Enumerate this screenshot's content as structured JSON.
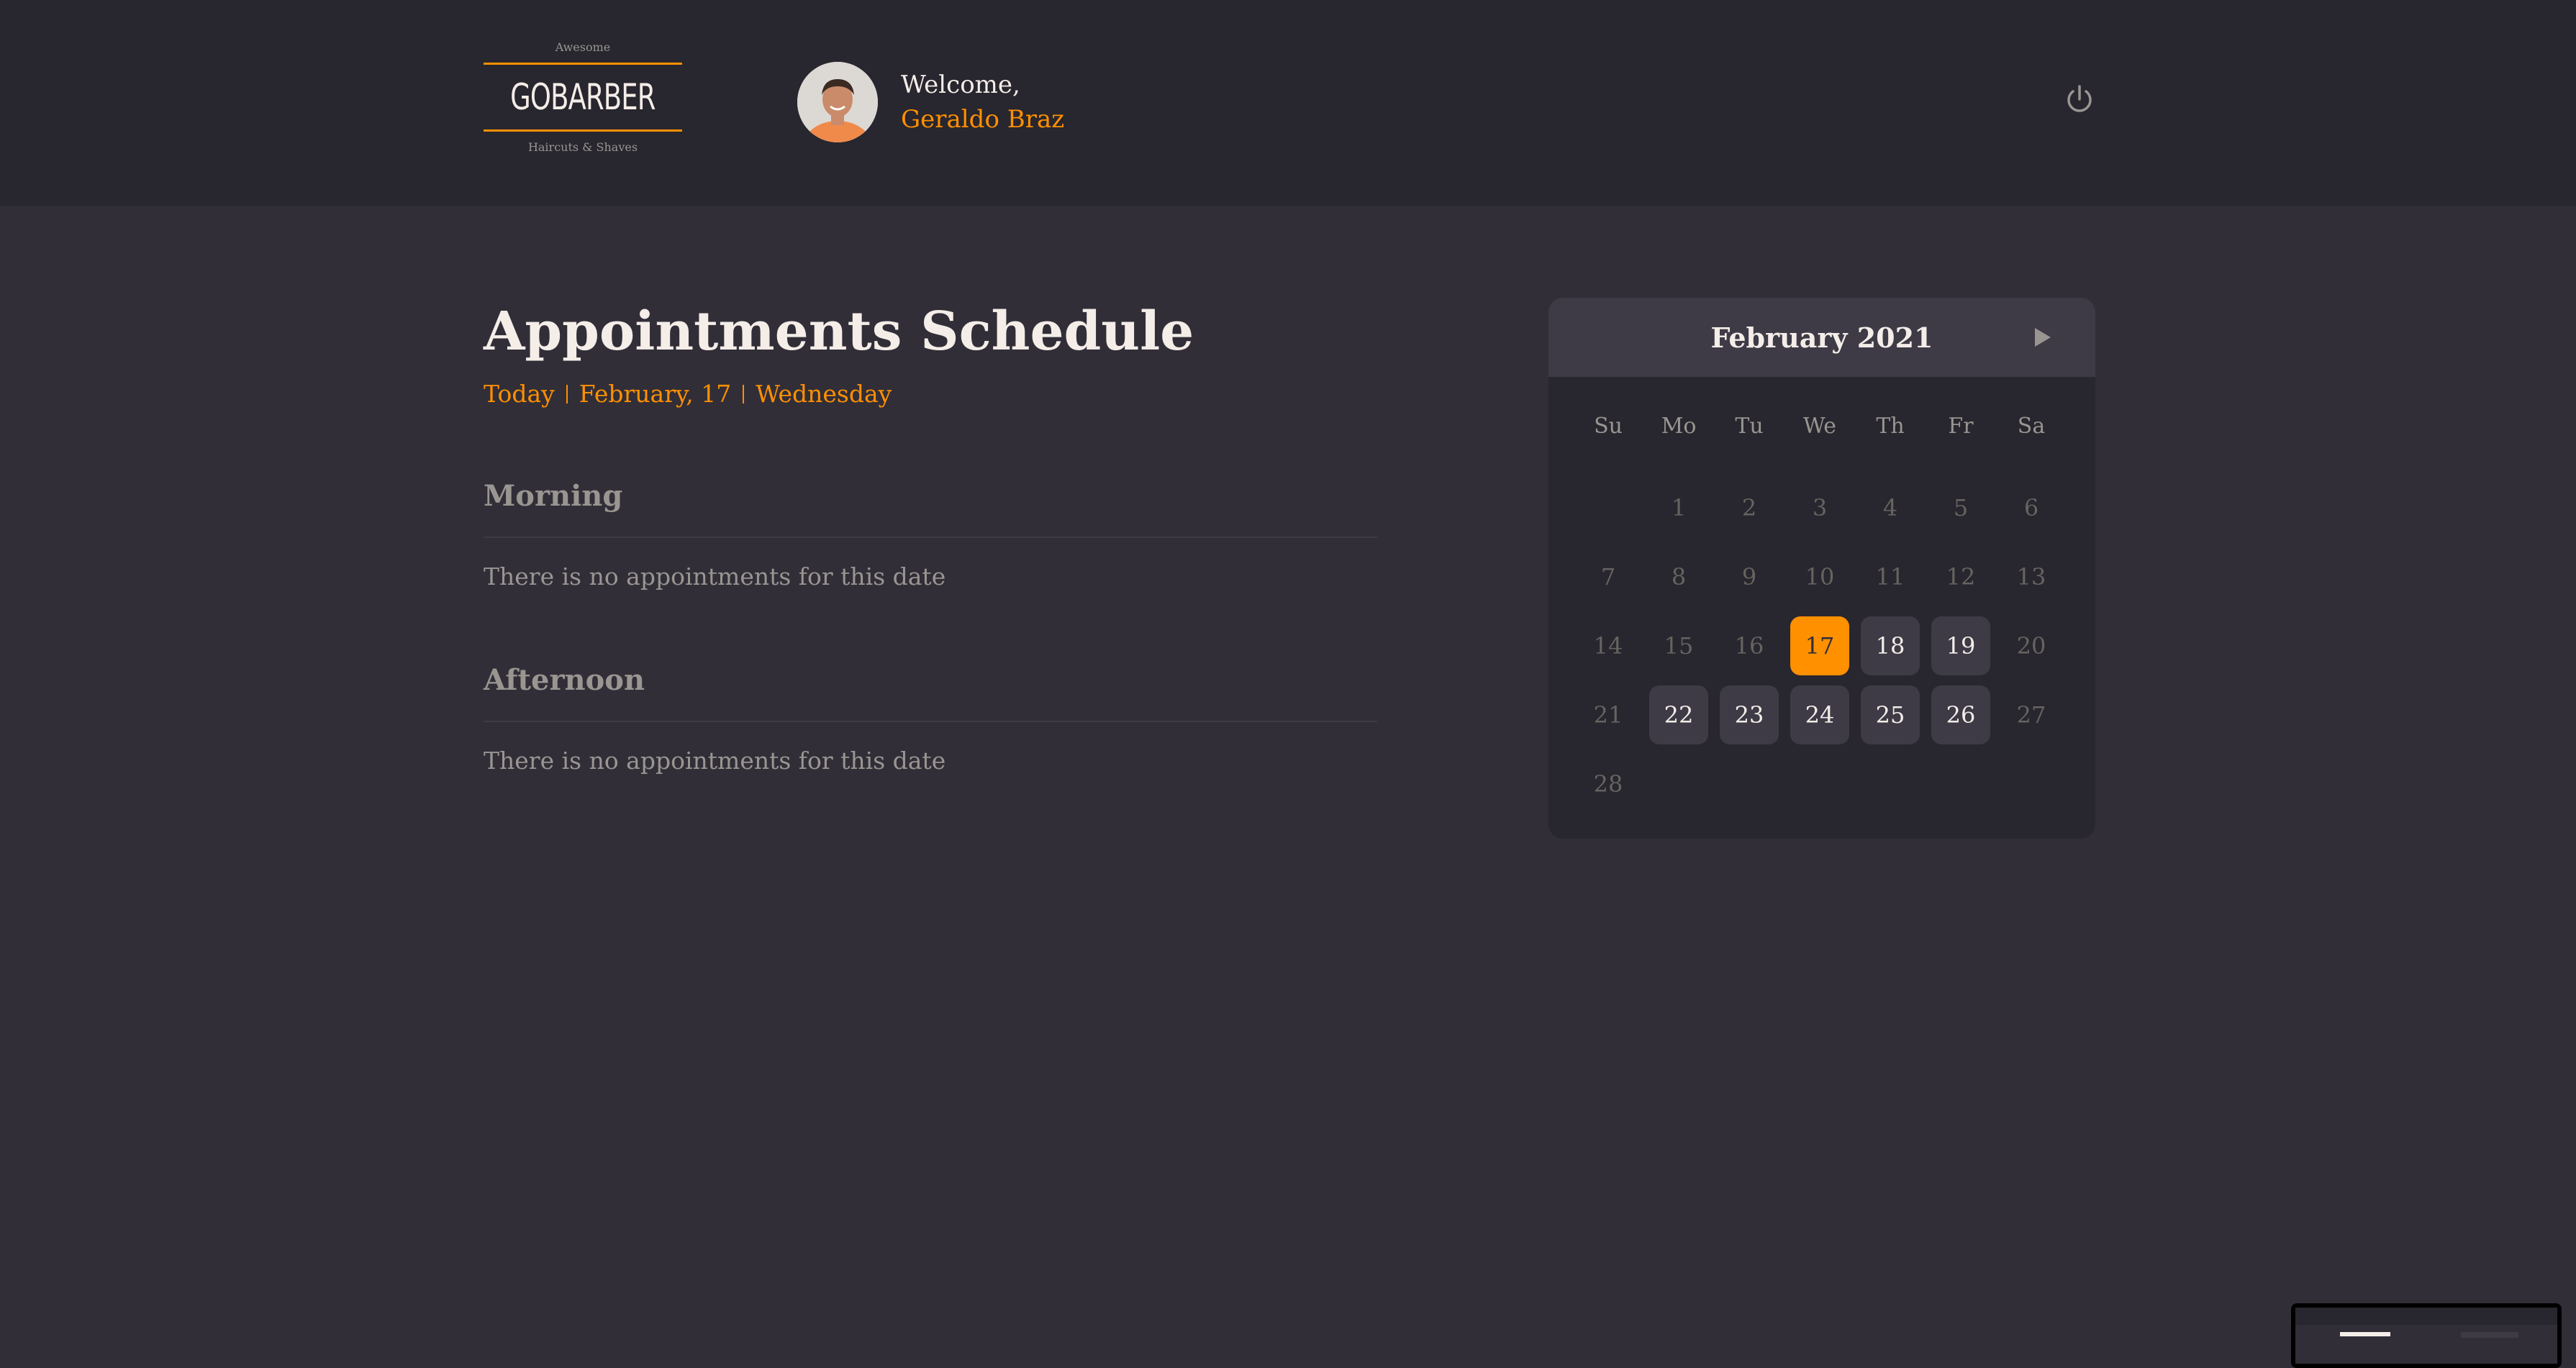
{
  "header": {
    "logo": {
      "top": "Awesome",
      "word": "GOBARBER",
      "bottom": "Haircuts & Shaves"
    },
    "welcome": "Welcome,",
    "user_name": "Geraldo Braz",
    "power_icon": "power-icon"
  },
  "main": {
    "title": "Appointments Schedule",
    "today": "Today",
    "date": "February, 17",
    "weekday": "Wednesday",
    "sections": [
      {
        "title": "Morning",
        "empty": "There is no appointments for this date"
      },
      {
        "title": "Afternoon",
        "empty": "There is no appointments for this date"
      }
    ]
  },
  "calendar": {
    "month": "February 2021",
    "next_icon": "chevron-right-icon",
    "weekdays": [
      "Su",
      "Mo",
      "Tu",
      "We",
      "Th",
      "Fr",
      "Sa"
    ],
    "days": [
      "",
      "1",
      "2",
      "3",
      "4",
      "5",
      "6",
      "7",
      "8",
      "9",
      "10",
      "11",
      "12",
      "13",
      "14",
      "15",
      "16",
      "17",
      "18",
      "19",
      "20",
      "21",
      "22",
      "23",
      "24",
      "25",
      "26",
      "27",
      "28"
    ],
    "selected": "17",
    "available": [
      "18",
      "19",
      "22",
      "23",
      "24",
      "25",
      "26"
    ]
  },
  "colors": {
    "accent": "#ff9000",
    "background": "#312e38",
    "header": "#28262e",
    "surface": "#3e3b47",
    "muted": "#999591",
    "text": "#f4ede8"
  }
}
